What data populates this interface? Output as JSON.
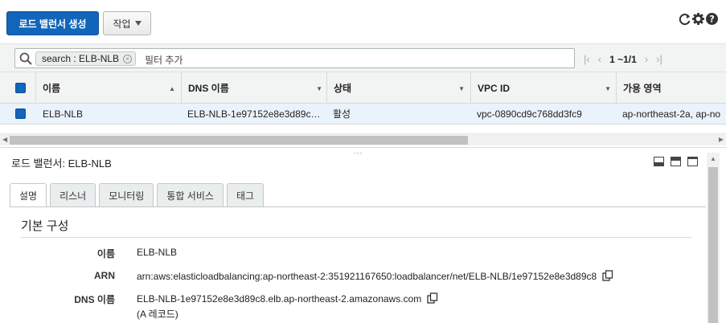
{
  "toolbar": {
    "create_label": "로드 밸런서 생성",
    "actions_label": "작업"
  },
  "search": {
    "token_label": "search : ELB-NLB",
    "placeholder": "필터 추가"
  },
  "pagination": {
    "count_text": "1 ~1/1"
  },
  "table": {
    "columns": [
      "이름",
      "DNS 이름",
      "상태",
      "VPC ID",
      "가용 영역"
    ],
    "rows": [
      {
        "name": "ELB-NLB",
        "dns": "ELB-NLB-1e97152e8e3d89c…",
        "state": "활성",
        "vpc": "vpc-0890cd9c768dd3fc9",
        "az": "ap-northeast-2a, ap-no"
      }
    ]
  },
  "details": {
    "title": "로드 밸런서: ELB-NLB",
    "tabs": [
      "설명",
      "리스너",
      "모니터링",
      "통합 서비스",
      "태그"
    ],
    "active_tab": "설명",
    "section_title": "기본 구성",
    "fields": {
      "name_label": "이름",
      "name_value": "ELB-NLB",
      "arn_label": "ARN",
      "arn_value": "arn:aws:elasticloadbalancing:ap-northeast-2:351921167650:loadbalancer/net/ELB-NLB/1e97152e8e3d89c8",
      "dns_label": "DNS 이름",
      "dns_value": "ELB-NLB-1e97152e8e3d89c8.elb.ap-northeast-2.amazonaws.com",
      "dns_note": "(A 레코드)"
    }
  },
  "colors": {
    "primary": "#1166bb",
    "row_selected": "#eaf3fb",
    "header_bg": "#f2f3f3"
  },
  "icons": [
    "refresh-icon",
    "gear-icon",
    "help-icon",
    "search-icon",
    "caret-down-icon",
    "copy-icon"
  ]
}
